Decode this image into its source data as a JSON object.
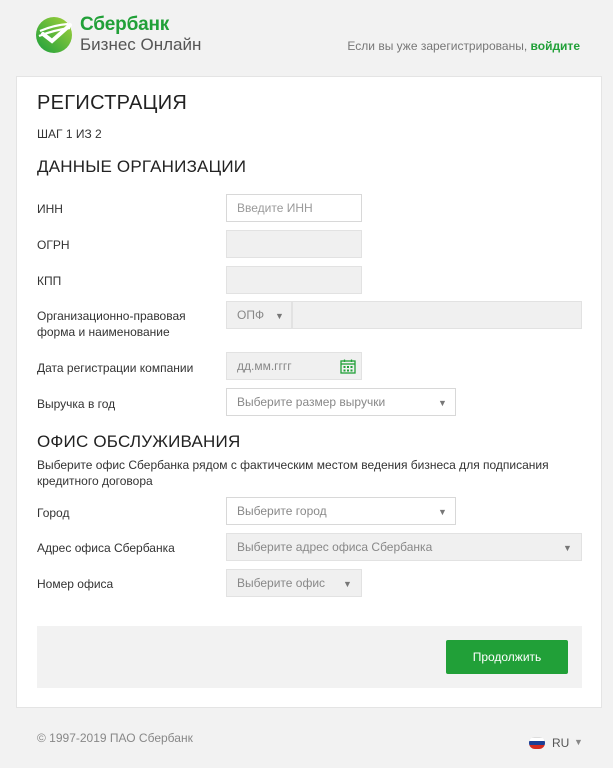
{
  "header": {
    "brand_name": "Сбербанк",
    "brand_sub": "Бизнес Онлайн",
    "login_prompt": "Если вы уже зарегистрированы,",
    "login_link": "войдите",
    "brand_color": "#21a038"
  },
  "form": {
    "title": "РЕГИСТРАЦИЯ",
    "step": "ШАГ 1 ИЗ 2",
    "org_section": "ДАННЫЕ ОРГАНИЗАЦИИ",
    "fields": {
      "inn": {
        "label": "ИНН",
        "placeholder": "Введите ИНН"
      },
      "ogrn": {
        "label": "ОГРН"
      },
      "kpp": {
        "label": "КПП"
      },
      "opf": {
        "label_line1": "Организационно-правовая",
        "label_line2": "форма и наименование",
        "select_value": "ОПФ"
      },
      "reg_date": {
        "label": "Дата регистрации компании",
        "placeholder": "дд.мм.гггг",
        "icon": "calendar-icon"
      },
      "revenue": {
        "label": "Выручка в год",
        "select_value": "Выберите размер выручки"
      }
    },
    "office_section": "ОФИС ОБСЛУЖИВАНИЯ",
    "office_desc": "Выберите офис Сбербанка рядом с фактическим местом ведения бизнеса для подписания кредитного договора",
    "office_fields": {
      "city": {
        "label": "Город",
        "select_value": "Выберите город"
      },
      "address": {
        "label": "Адрес офиса Сбербанка",
        "select_value": "Выберите адрес офиса Сбербанка"
      },
      "office_number": {
        "label": "Номер офиса",
        "select_value": "Выберите офис"
      }
    },
    "continue_label": "Продолжить"
  },
  "footer": {
    "copyright": "© 1997-2019 ПАО Сбербанк",
    "language": "RU"
  }
}
